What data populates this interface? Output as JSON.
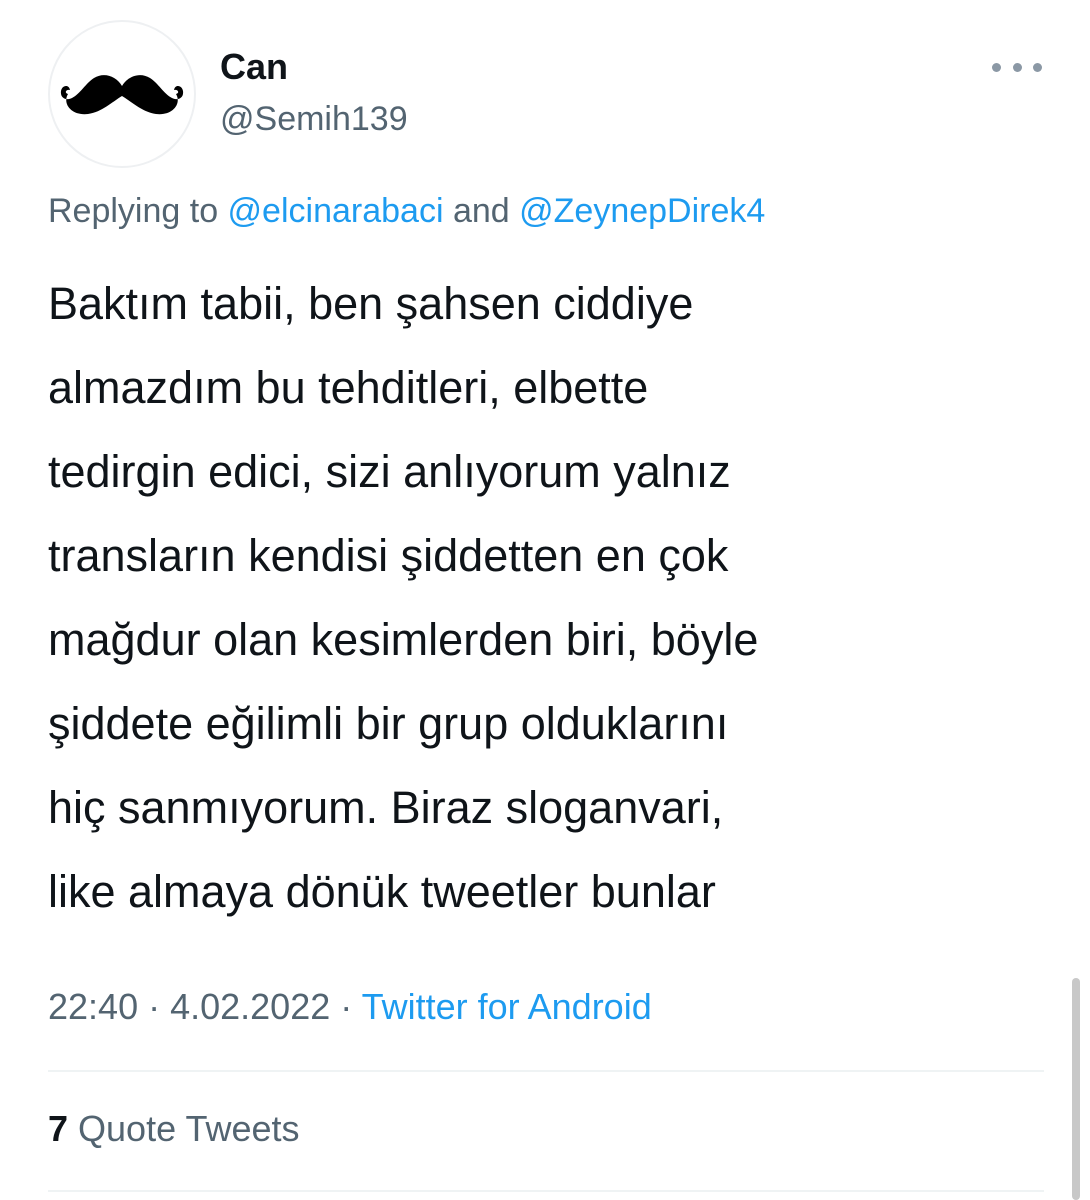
{
  "author": {
    "display_name": "Can",
    "handle": "@Semih139",
    "avatar_icon": "mustache-icon"
  },
  "reply": {
    "prefix": "Replying to ",
    "mentions": [
      "@elcinarabaci",
      "@ZeynepDirek4"
    ],
    "joiner": " and "
  },
  "tweet": {
    "text": "Baktım tabii, ben şahsen ciddiye\nalmazdım bu tehditleri, elbette\ntedirgin edici, sizi anlıyorum yalnız\ntransların kendisi şiddetten en çok\nmağdur olan kesimlerden biri, böyle\nşiddete eğilimli bir grup olduklarını\nhiç sanmıyorum. Biraz sloganvari,\nlike almaya dönük tweetler bunlar"
  },
  "meta": {
    "time": "22:40",
    "separator": " · ",
    "date": "4.02.2022",
    "source": "Twitter for Android"
  },
  "stats": {
    "quote_count": "7",
    "quote_label": " Quote Tweets"
  },
  "colors": {
    "link": "#1d9bf0",
    "secondary_text": "#536471",
    "primary_text": "#0f1419"
  }
}
